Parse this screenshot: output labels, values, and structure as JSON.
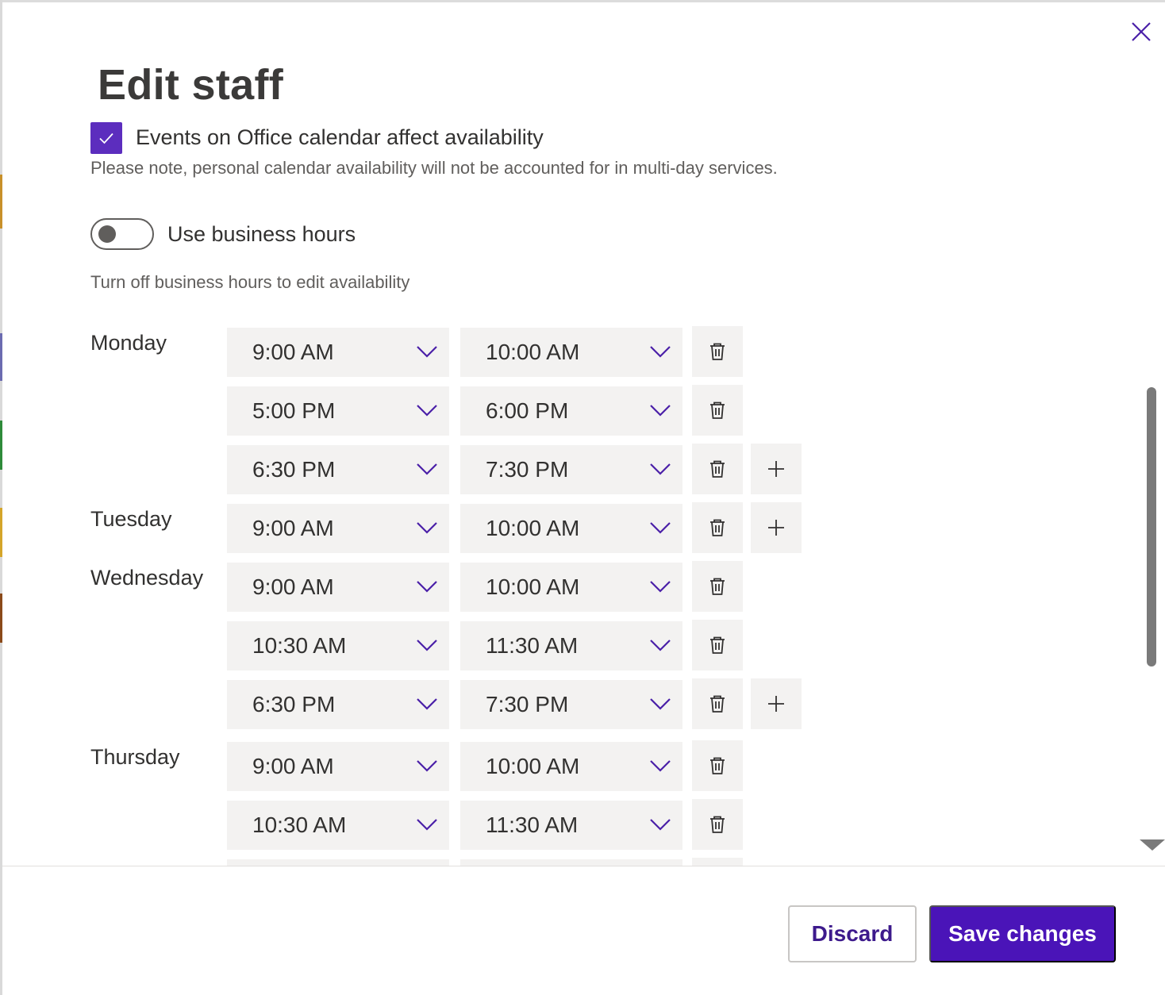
{
  "dialog": {
    "title": "Edit staff",
    "close_icon": "close-icon",
    "accent_color": "#4a14b8"
  },
  "calendar_option": {
    "checked": true,
    "label": "Events on Office calendar affect availability",
    "note": "Please note, personal calendar availability will not be accounted for in multi-day services."
  },
  "business_hours": {
    "enabled": false,
    "label": "Use business hours",
    "hint": "Turn off business hours to edit availability"
  },
  "days": [
    {
      "name": "Monday",
      "slots": [
        {
          "start": "9:00 AM",
          "end": "10:00 AM"
        },
        {
          "start": "5:00 PM",
          "end": "6:00 PM"
        },
        {
          "start": "6:30 PM",
          "end": "7:30 PM"
        }
      ]
    },
    {
      "name": "Tuesday",
      "slots": [
        {
          "start": "9:00 AM",
          "end": "10:00 AM"
        }
      ]
    },
    {
      "name": "Wednesday",
      "slots": [
        {
          "start": "9:00 AM",
          "end": "10:00 AM"
        },
        {
          "start": "10:30 AM",
          "end": "11:30 AM"
        },
        {
          "start": "6:30 PM",
          "end": "7:30 PM"
        }
      ]
    },
    {
      "name": "Thursday",
      "slots": [
        {
          "start": "9:00 AM",
          "end": "10:00 AM"
        },
        {
          "start": "10:30 AM",
          "end": "11:30 AM"
        },
        {
          "start": "",
          "end": ""
        }
      ]
    }
  ],
  "icons": {
    "delete": "trash-icon",
    "add": "plus-icon",
    "dropdown": "chevron-down-icon"
  },
  "footer": {
    "discard_label": "Discard",
    "save_label": "Save changes"
  }
}
